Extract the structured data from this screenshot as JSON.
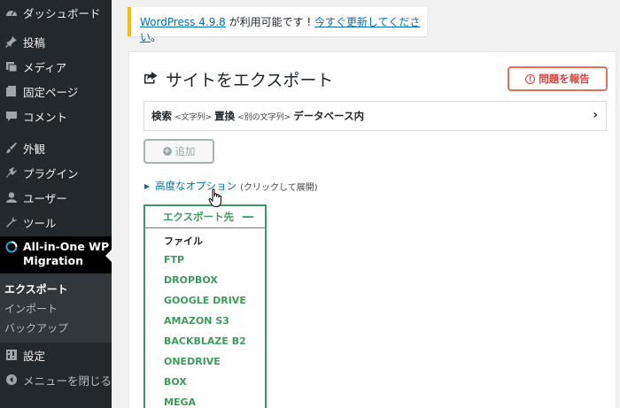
{
  "sidebar": {
    "items": [
      {
        "label": "ダッシュボード",
        "icon": "dashboard-icon"
      },
      {
        "label": "投稿",
        "icon": "pin-icon"
      },
      {
        "label": "メディア",
        "icon": "media-icon"
      },
      {
        "label": "固定ページ",
        "icon": "page-icon"
      },
      {
        "label": "コメント",
        "icon": "comment-icon"
      },
      {
        "label": "外観",
        "icon": "brush-icon"
      },
      {
        "label": "プラグイン",
        "icon": "plugin-icon"
      },
      {
        "label": "ユーザー",
        "icon": "user-icon"
      },
      {
        "label": "ツール",
        "icon": "wrench-icon"
      }
    ],
    "current": {
      "label_line1": "All-in-One WP",
      "label_line2": "Migration",
      "icon": "migration-icon"
    },
    "submenu": [
      "エクスポート",
      "インポート",
      "バックアップ"
    ],
    "settings": {
      "label": "設定",
      "icon": "settings-icon"
    },
    "collapse": {
      "label": "メニューを閉じる",
      "icon": "collapse-icon"
    }
  },
  "notice": {
    "link_version": "WordPress 4.9.8",
    "text": " が利用可能です ! ",
    "link_update": "今すぐ更新してください",
    "end": "。",
    "accent": "#ffb900"
  },
  "panel": {
    "title": "サイトをエクスポート",
    "report_button": "問題を報告",
    "search_replace": {
      "search": "検索",
      "search_hint": "<文字列>",
      "replace": "置換",
      "replace_hint": "<別の文字列>",
      "scope": "データベース内"
    },
    "add_button": "追加",
    "advanced_link": "高度なオプション",
    "advanced_hint": "(クリックして展開)",
    "export_to": {
      "header": "エクスポート先",
      "options": [
        "ファイル",
        "FTP",
        "DROPBOX",
        "GOOGLE DRIVE",
        "AMAZON S3",
        "BACKBLAZE B2",
        "ONEDRIVE",
        "BOX",
        "MEGA"
      ]
    }
  },
  "colors": {
    "sidebar_bg": "#23282d",
    "accent_green": "#3d9b5d",
    "report_red": "#d9423a",
    "link_blue": "#0073aa"
  }
}
